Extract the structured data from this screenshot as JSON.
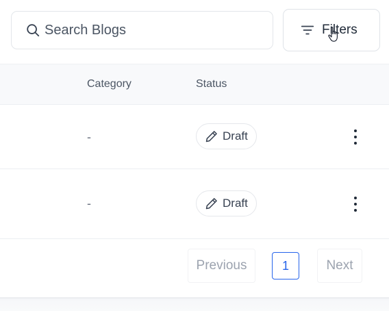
{
  "search": {
    "placeholder": "Search Blogs",
    "value": ""
  },
  "toolbar": {
    "filters_label": "Filters"
  },
  "table": {
    "columns": [
      "Category",
      "Status"
    ],
    "rows": [
      {
        "category": "-",
        "status": "Draft"
      },
      {
        "category": "-",
        "status": "Draft"
      }
    ]
  },
  "pagination": {
    "previous_label": "Previous",
    "current_page": "1",
    "next_label": "Next"
  },
  "colors": {
    "accent": "#2563eb",
    "border": "#e5e7eb",
    "header_bg": "#f8f9fb"
  },
  "icons": [
    "search-icon",
    "filter-icon",
    "pencil-icon",
    "kebab-menu-icon",
    "hand-cursor-icon"
  ]
}
